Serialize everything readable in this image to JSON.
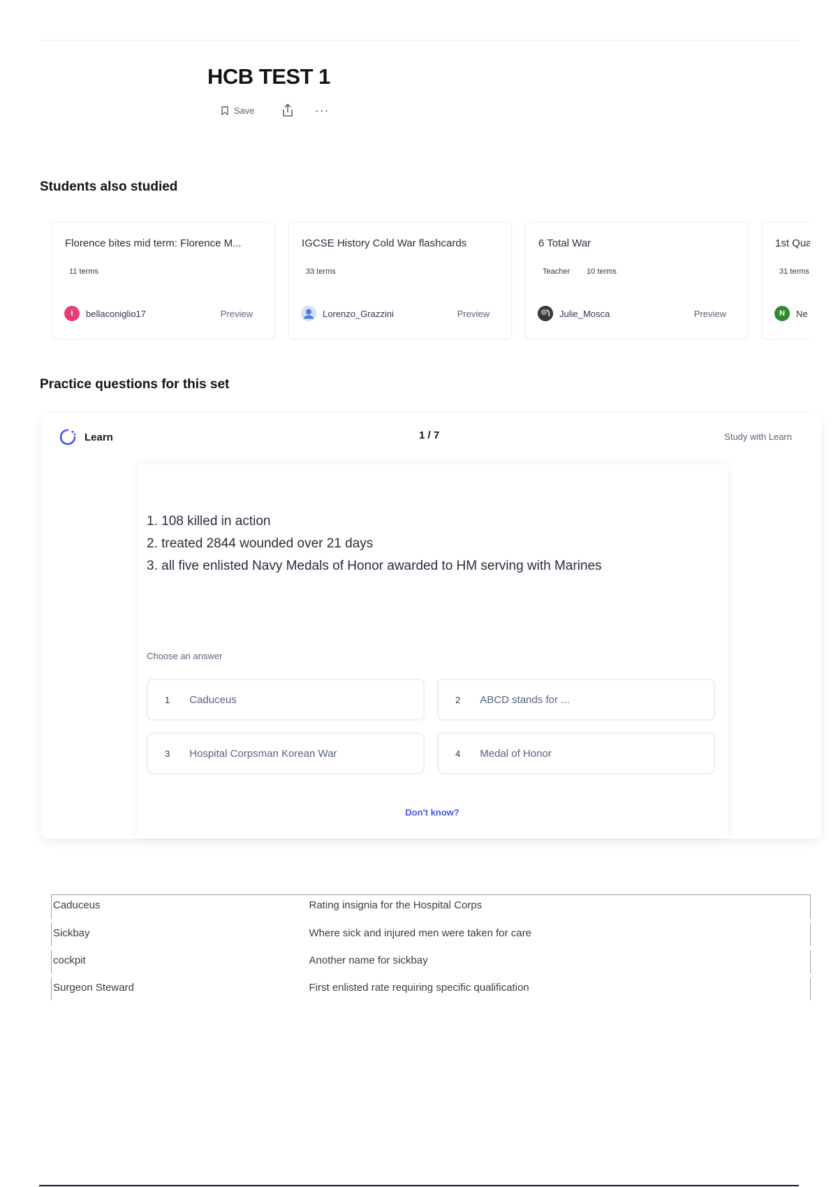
{
  "set": {
    "title": "HCB TEST 1",
    "actions": {
      "save_label": "Save"
    }
  },
  "students_also_studied": {
    "heading": "Students also studied",
    "cards": [
      {
        "title": "Florence bites mid term: Florence M...",
        "meta": [
          "11 terms"
        ],
        "user": "bellaconiglio17",
        "avatar_letter": "i",
        "avatar_color": "#e93d76",
        "preview": "Preview"
      },
      {
        "title": "IGCSE History Cold War flashcards",
        "meta": [
          "33 terms"
        ],
        "user": "Lorenzo_Grazzini",
        "avatar_letter": "",
        "avatar_color": "#4c7fe0",
        "preview": "Preview"
      },
      {
        "title": "6 Total War",
        "meta": [
          "Teacher",
          "10 terms"
        ],
        "user": "Julie_Mosca",
        "avatar_letter": "",
        "avatar_color": "#2b2b2b",
        "preview": "Preview"
      },
      {
        "title": "1st Qua",
        "meta": [
          "31 terms"
        ],
        "user": "Ne",
        "avatar_letter": "N",
        "avatar_color": "#2e8b2e",
        "preview": ""
      }
    ]
  },
  "practice": {
    "heading": "Practice questions for this set",
    "learn_label": "Learn",
    "counter": "1 / 7",
    "study_link": "Study with Learn",
    "question_lines": [
      "1. 108 killed in action",
      "2. treated 2844 wounded over 21 days",
      "3. all five enlisted Navy Medals of Honor awarded to HM serving with Marines"
    ],
    "choose_label": "Choose an answer",
    "options": [
      {
        "num": "1",
        "text": "Caduceus"
      },
      {
        "num": "2",
        "text": "ABCD stands for ..."
      },
      {
        "num": "3",
        "text": "Hospital Corpsman Korean War"
      },
      {
        "num": "4",
        "text": "Medal of Honor"
      }
    ],
    "dont_know": "Don't know?"
  },
  "terms": [
    {
      "term": "Caduceus",
      "definition": "Rating insignia for the Hospital Corps"
    },
    {
      "term": "Sickbay",
      "definition": "Where sick and injured men were taken for care"
    },
    {
      "term": "cockpit",
      "definition": "Another name for sickbay"
    },
    {
      "term": "Surgeon Steward",
      "definition": "First enlisted rate requiring specific qualification"
    }
  ],
  "colors": {
    "accent": "#4255ff",
    "text": "#282e3e",
    "muted": "#586380"
  }
}
